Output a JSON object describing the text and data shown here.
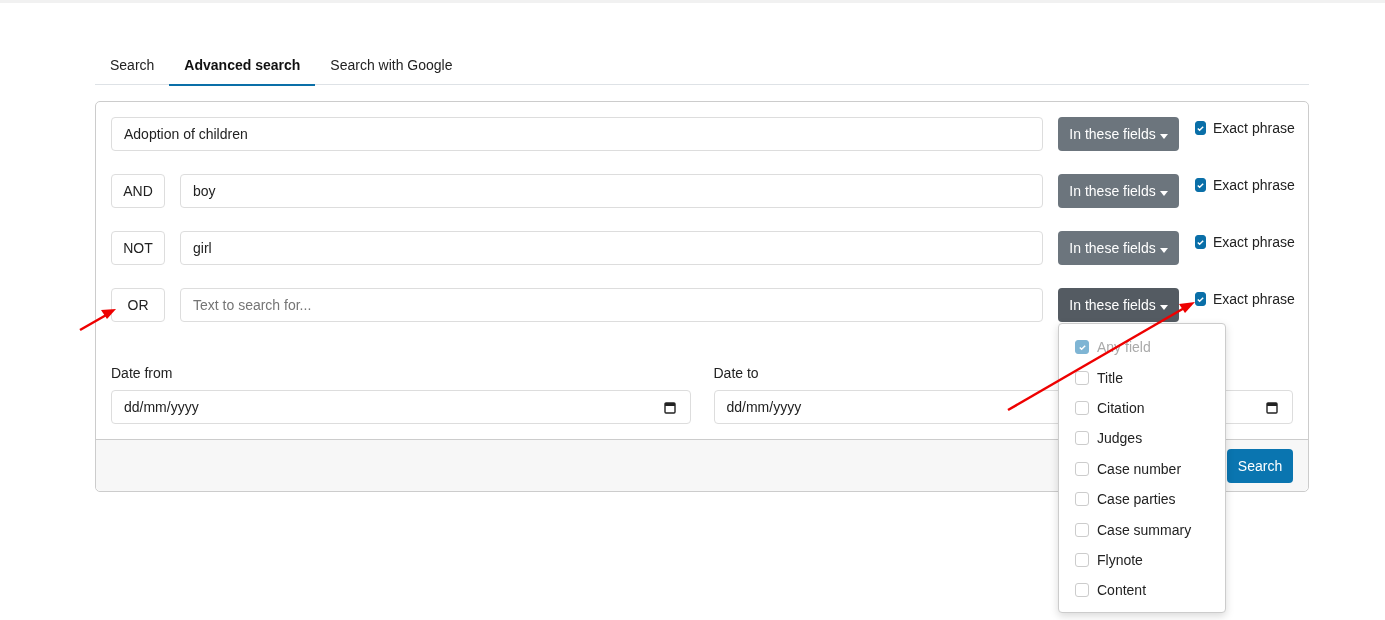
{
  "tabs": [
    {
      "label": "Search",
      "selected": false
    },
    {
      "label": "Advanced search",
      "selected": true
    },
    {
      "label": "Search with Google",
      "selected": false
    }
  ],
  "rows": [
    {
      "operator": null,
      "value": "Adoption of children",
      "placeholder": null,
      "fields_button": "In these fields",
      "open": false,
      "exact": {
        "label": "Exact phrase",
        "checked": true
      }
    },
    {
      "operator": "AND",
      "value": "boy",
      "placeholder": null,
      "fields_button": "In these fields",
      "open": false,
      "exact": {
        "label": "Exact phrase",
        "checked": true
      }
    },
    {
      "operator": "NOT",
      "value": "girl",
      "placeholder": null,
      "fields_button": "In these fields",
      "open": false,
      "exact": {
        "label": "Exact phrase",
        "checked": true
      }
    },
    {
      "operator": "OR",
      "value": null,
      "placeholder": "Text to search for...",
      "fields_button": "In these fields",
      "open": true,
      "exact": {
        "label": "Exact phrase",
        "checked": true
      }
    }
  ],
  "field_menu": [
    {
      "label": "Any field",
      "checked": true,
      "disabled": true
    },
    {
      "label": "Title",
      "checked": false,
      "disabled": false
    },
    {
      "label": "Citation",
      "checked": false,
      "disabled": false
    },
    {
      "label": "Judges",
      "checked": false,
      "disabled": false
    },
    {
      "label": "Case number",
      "checked": false,
      "disabled": false
    },
    {
      "label": "Case parties",
      "checked": false,
      "disabled": false
    },
    {
      "label": "Case summary",
      "checked": false,
      "disabled": false
    },
    {
      "label": "Flynote",
      "checked": false,
      "disabled": false
    },
    {
      "label": "Content",
      "checked": false,
      "disabled": false
    }
  ],
  "dates": [
    {
      "label": "Date from",
      "placeholder": "dd/mm/yyyy"
    },
    {
      "label": "Date to",
      "placeholder": "dd/mm/yyyy"
    }
  ],
  "search_button": "Search"
}
